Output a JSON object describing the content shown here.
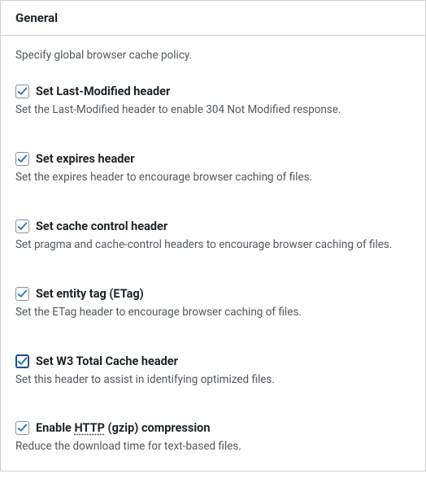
{
  "panel": {
    "title": "General",
    "intro": "Specify global browser cache policy."
  },
  "settings": [
    {
      "label": "Set Last-Modified header",
      "desc": "Set the Last-Modified header to enable 304 Not Modified response."
    },
    {
      "label": "Set expires header",
      "desc": "Set the expires header to encourage browser caching of files."
    },
    {
      "label": "Set cache control header",
      "desc": "Set pragma and cache-control headers to encourage browser caching of files."
    },
    {
      "label": "Set entity tag (ETag)",
      "desc": "Set the ETag header to encourage browser caching of files."
    },
    {
      "label": "Set W3 Total Cache header",
      "desc": "Set this header to assist in identifying optimized files."
    },
    {
      "label_prefix": "Enable ",
      "label_abbr": "HTTP",
      "label_suffix": " (gzip) compression",
      "desc": "Reduce the download time for text-based files."
    }
  ]
}
